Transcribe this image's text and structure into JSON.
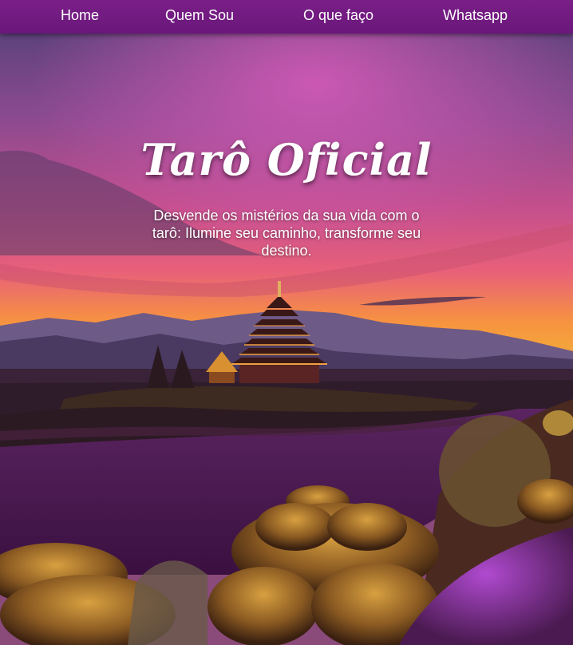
{
  "nav": {
    "items": [
      {
        "label": "Home"
      },
      {
        "label": "Quem Sou"
      },
      {
        "label": "O que faço"
      },
      {
        "label": "Whatsapp"
      }
    ]
  },
  "hero": {
    "title": "Tarô Oficial",
    "subtitle": "Desvende os mistérios da sua vida com o tarô: Ilumine seu caminho, transforme seu destino."
  },
  "colors": {
    "navbar": "#6f1a80",
    "sky_top": "#4a3a70",
    "sky_glow": "#e05a8a",
    "horizon": "#f6a23a",
    "water": "#4a1a52"
  }
}
